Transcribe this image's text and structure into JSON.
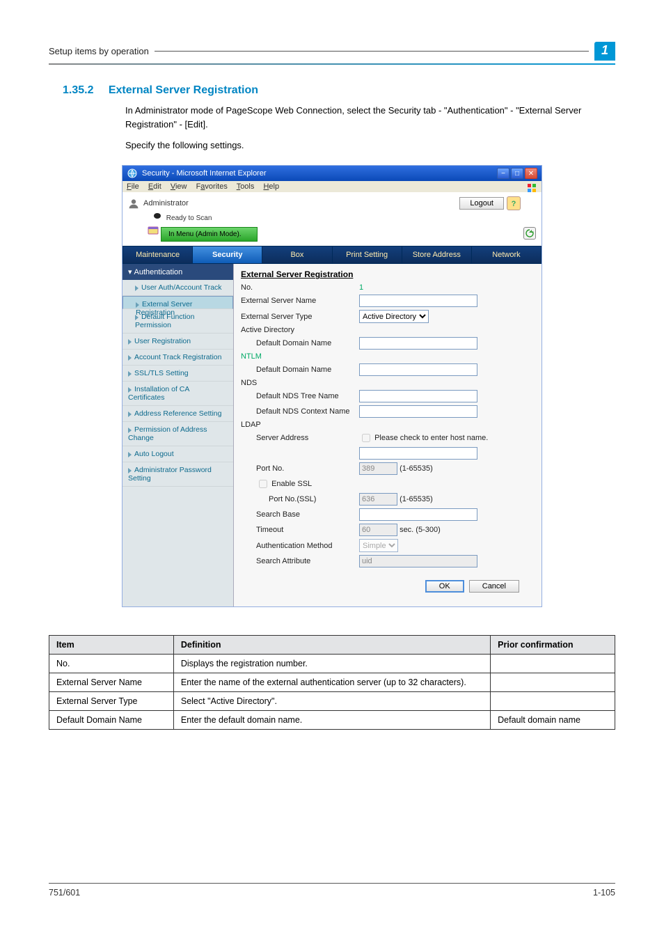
{
  "header": {
    "breadcrumb": "Setup items by operation",
    "badge": "1"
  },
  "section": {
    "number": "1.35.2",
    "title": "External Server Registration",
    "para1": "In Administrator mode of PageScope Web Connection, select the Security tab - \"Authentication\" - \"External Server Registration\" - [Edit].",
    "para2": "Specify the following settings."
  },
  "app": {
    "title": "Security - Microsoft Internet Explorer",
    "menus": [
      "File",
      "Edit",
      "View",
      "Favorites",
      "Tools",
      "Help"
    ],
    "adminLabel": "Administrator",
    "readyToScan": "Ready to Scan",
    "menuMode": "In Menu (Admin Mode).",
    "logout": "Logout",
    "tabs": {
      "maintenance": "Maintenance",
      "security": "Security",
      "box": "Box",
      "print": "Print Setting",
      "store": "Store Address",
      "network": "Network"
    },
    "sidebar": {
      "authHeader": "Authentication",
      "userAuth": "User Auth/Account Track",
      "extServer": "External Server Registration",
      "defaultFunc": "Default Function Permission",
      "userReg": "User Registration",
      "acctTrack": "Account Track Registration",
      "ssl": "SSL/TLS Setting",
      "caCert": "Installation of CA Certificates",
      "addrRef": "Address Reference Setting",
      "permAddr": "Permission of Address Change",
      "autoLogout": "Auto Logout",
      "adminPwd": "Administrator Password Setting"
    },
    "form": {
      "heading": "External Server Registration",
      "noLabel": "No.",
      "noValue": "1",
      "extNameLabel": "External Server Name",
      "extTypeLabel": "External Server Type",
      "extTypeValue": "Active Directory",
      "ad": "Active Directory",
      "adDomain": "Default Domain Name",
      "ntlm": "NTLM",
      "ntlmDomain": "Default Domain Name",
      "nds": "NDS",
      "ndsTree": "Default NDS Tree Name",
      "ndsContext": "Default NDS Context Name",
      "ldap": "LDAP",
      "serverAddr": "Server Address",
      "hostnameChk": "Please check to enter host name.",
      "portNo": "Port No.",
      "portNoVal": "389",
      "portRange": "(1-65535)",
      "enableSSL": "Enable SSL",
      "portSSL": "Port No.(SSL)",
      "portSSLVal": "636",
      "searchBase": "Search Base",
      "timeout": "Timeout",
      "timeoutVal": "60",
      "timeoutRange": "sec. (5-300)",
      "authMethod": "Authentication Method",
      "authMethodVal": "Simple",
      "searchAttr": "Search Attribute",
      "searchAttrVal": "uid",
      "ok": "OK",
      "cancel": "Cancel"
    }
  },
  "table": {
    "headers": {
      "item": "Item",
      "def": "Definition",
      "prior": "Prior confirmation"
    },
    "rows": [
      {
        "item": "No.",
        "def": "Displays the registration number.",
        "prior": ""
      },
      {
        "item": "External Server Name",
        "def": "Enter the name of the external authentication server (up to 32 characters).",
        "prior": ""
      },
      {
        "item": "External Server Type",
        "def": "Select \"Active Directory\".",
        "prior": ""
      },
      {
        "item": "Default Domain Name",
        "def": "Enter the default domain name.",
        "prior": "Default domain name"
      }
    ]
  },
  "footer": {
    "left": "751/601",
    "right": "1-105"
  }
}
